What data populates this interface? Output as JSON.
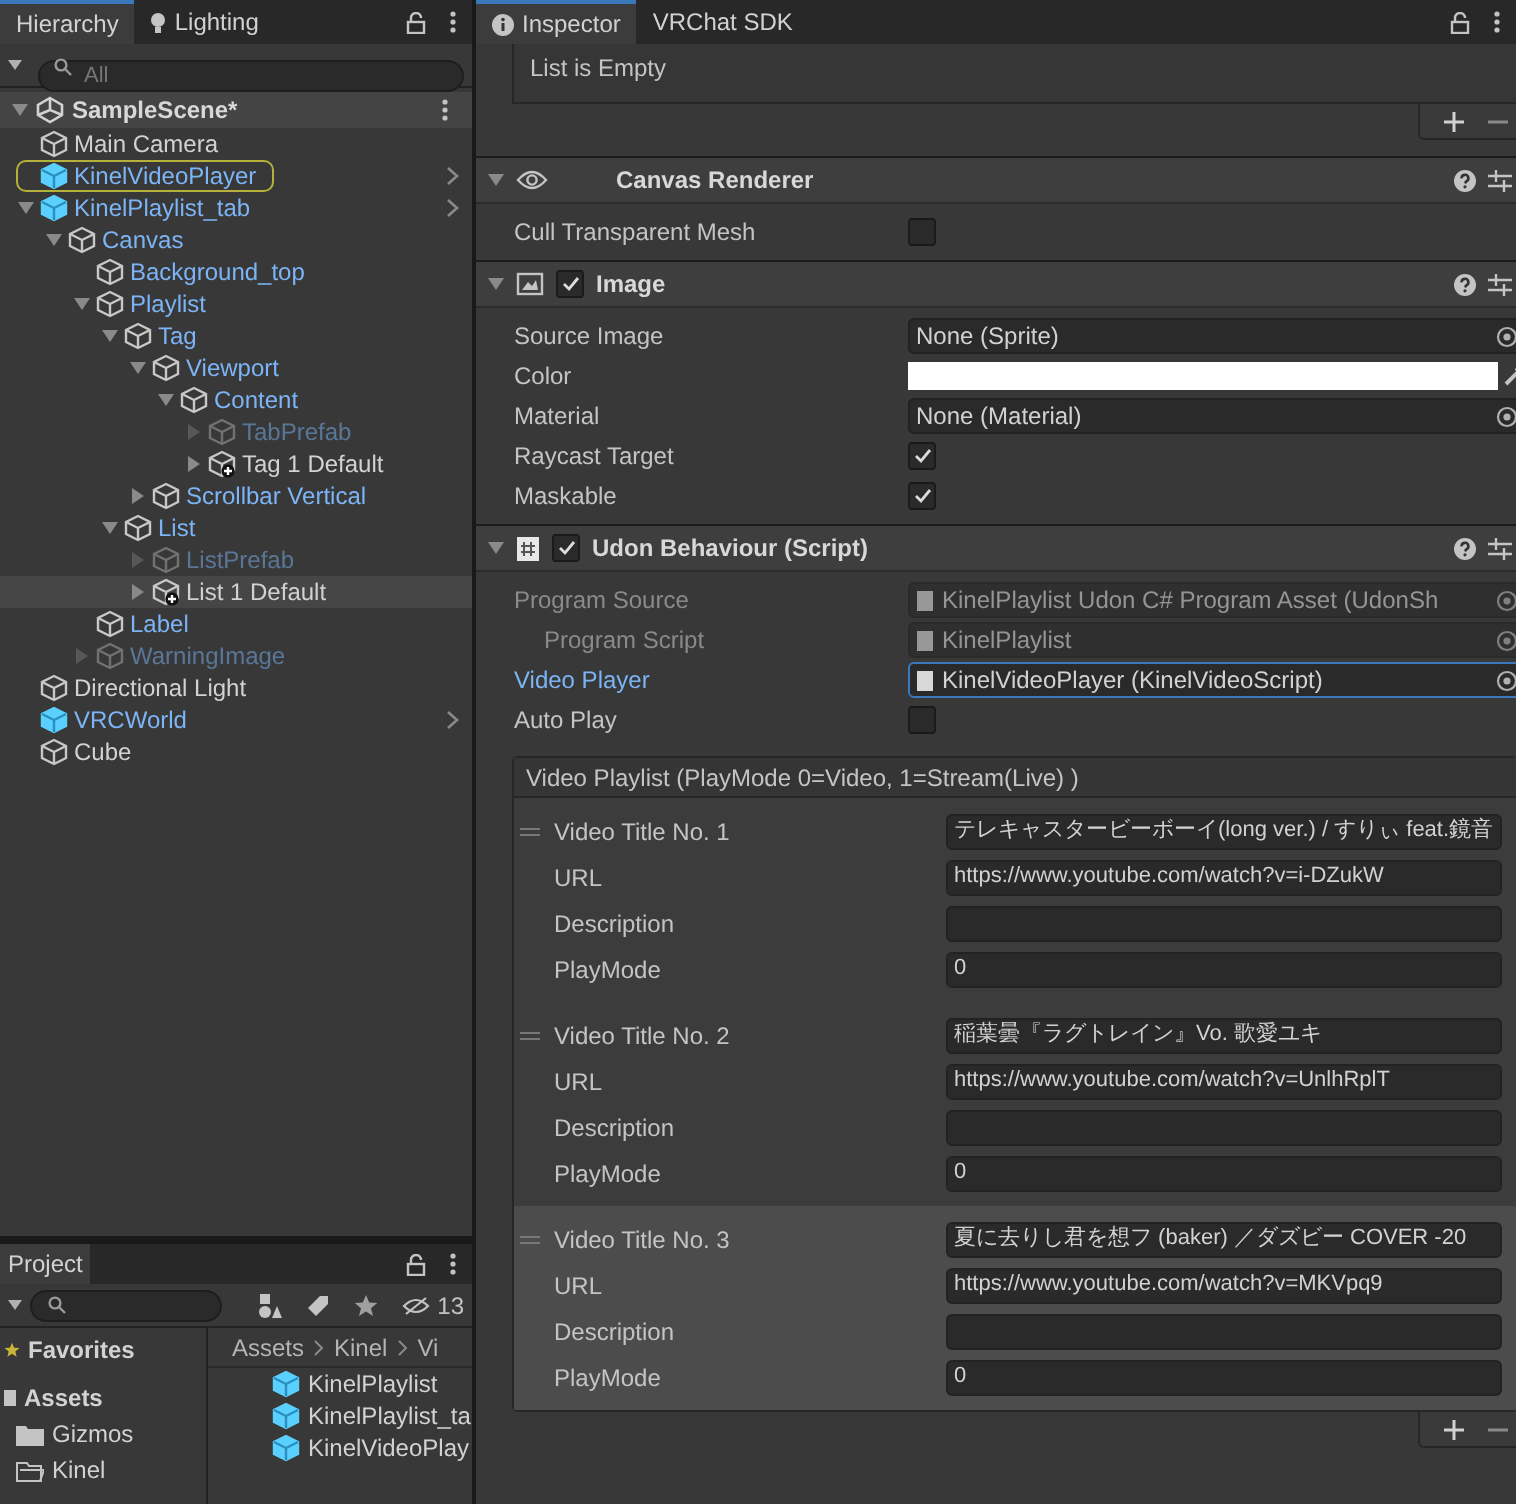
{
  "hierarchy": {
    "tabs": [
      {
        "label": "Hierarchy",
        "selected": true
      },
      {
        "label": "Lighting",
        "selected": false
      }
    ],
    "search": {
      "placeholder": "All"
    },
    "scene": {
      "name": "SampleScene*",
      "expanded": true,
      "children": [
        {
          "name": "Main Camera",
          "kind": "plain",
          "inactive": false,
          "selected": false,
          "hovered": false
        },
        {
          "name": "KinelVideoPlayer",
          "kind": "prefab_root",
          "inactive": false,
          "selected": true,
          "hovered": false
        },
        {
          "name": "KinelPlaylist_tab",
          "kind": "prefab_root",
          "inactive": false,
          "selected": false,
          "hovered": false,
          "expanded": true,
          "children": [
            {
              "name": "Canvas",
              "kind": "prefab",
              "inactive": false,
              "selected": false,
              "hovered": false,
              "expanded": true,
              "children": [
                {
                  "name": "Background_top",
                  "kind": "prefab",
                  "inactive": false,
                  "selected": false,
                  "hovered": false
                },
                {
                  "name": "Playlist",
                  "kind": "prefab",
                  "inactive": false,
                  "selected": false,
                  "hovered": false,
                  "expanded": true,
                  "children": [
                    {
                      "name": "Tag",
                      "kind": "prefab",
                      "inactive": false,
                      "selected": false,
                      "hovered": false,
                      "expanded": true,
                      "children": [
                        {
                          "name": "Viewport",
                          "kind": "prefab",
                          "inactive": false,
                          "selected": false,
                          "hovered": false,
                          "expanded": true,
                          "children": [
                            {
                              "name": "Content",
                              "kind": "prefab",
                              "inactive": false,
                              "selected": false,
                              "hovered": false,
                              "expanded": true,
                              "children": [
                                {
                                  "name": "TabPrefab",
                                  "kind": "prefab",
                                  "inactive": true,
                                  "selected": false,
                                  "hovered": false,
                                  "expanded": false
                                },
                                {
                                  "name": "Tag 1 Default",
                                  "kind": "added",
                                  "inactive": false,
                                  "selected": false,
                                  "hovered": false,
                                  "expanded": false
                                }
                              ]
                            }
                          ]
                        },
                        {
                          "name": "Scrollbar Vertical",
                          "kind": "prefab",
                          "inactive": false,
                          "selected": false,
                          "hovered": false,
                          "expanded": false
                        }
                      ]
                    },
                    {
                      "name": "List",
                      "kind": "prefab",
                      "inactive": false,
                      "selected": false,
                      "hovered": false,
                      "expanded": true,
                      "children": [
                        {
                          "name": "ListPrefab",
                          "kind": "prefab",
                          "inactive": true,
                          "selected": false,
                          "hovered": false,
                          "expanded": false
                        },
                        {
                          "name": "List 1 Default",
                          "kind": "added",
                          "inactive": false,
                          "selected": false,
                          "hovered": true,
                          "expanded": false
                        }
                      ]
                    }
                  ]
                },
                {
                  "name": "Label",
                  "kind": "prefab",
                  "inactive": false,
                  "selected": false,
                  "hovered": false
                },
                {
                  "name": "WarningImage",
                  "kind": "prefab",
                  "inactive": true,
                  "selected": false,
                  "hovered": false,
                  "expanded": false
                }
              ]
            }
          ]
        },
        {
          "name": "Directional Light",
          "kind": "plain",
          "inactive": false,
          "selected": false,
          "hovered": false
        },
        {
          "name": "VRCWorld",
          "kind": "prefab_root",
          "inactive": false,
          "selected": false,
          "hovered": false
        },
        {
          "name": "Cube",
          "kind": "plain",
          "inactive": false,
          "selected": false,
          "hovered": false
        }
      ]
    }
  },
  "project": {
    "tab": "Project",
    "hidden_count": "13",
    "favorites": "Favorites",
    "assets": "Assets",
    "folders": [
      {
        "name": "Gizmos",
        "expanded": false
      },
      {
        "name": "Kinel",
        "expanded": true
      }
    ],
    "breadcrumb": [
      "Assets",
      "Kinel",
      "Vi"
    ],
    "files": [
      "KinelPlaylist",
      "KinelPlaylist_ta",
      "KinelVideoPlay"
    ]
  },
  "inspector": {
    "tabs": [
      {
        "label": "Inspector",
        "selected": true
      },
      {
        "label": "VRChat SDK",
        "selected": false
      }
    ],
    "empty_list": "List is Empty",
    "components": [
      {
        "title": "Canvas Renderer",
        "fields": [
          {
            "label": "Cull Transparent Mesh",
            "kind": "checkbox",
            "checked": false
          }
        ]
      },
      {
        "title": "Image",
        "enabled": true,
        "fields": [
          {
            "label": "Source Image",
            "kind": "object",
            "value": "None (Sprite)"
          },
          {
            "label": "Color",
            "kind": "color",
            "color": "#ffffff"
          },
          {
            "label": "Material",
            "kind": "object",
            "value": "None (Material)"
          },
          {
            "label": "Raycast Target",
            "kind": "checkbox",
            "checked": true
          },
          {
            "label": "Maskable",
            "kind": "checkbox",
            "checked": true
          }
        ]
      },
      {
        "title": "Udon Behaviour (Script)",
        "enabled": true,
        "fields": [
          {
            "label": "Program Source",
            "kind": "object",
            "value": "KinelPlaylist Udon C# Program Asset (UdonSh",
            "disabled": true,
            "indent": false,
            "focused": false
          },
          {
            "label": "Program Script",
            "kind": "object",
            "value": "KinelPlaylist",
            "disabled": true,
            "indent": true,
            "focused": false
          },
          {
            "label": "Video Player",
            "kind": "object",
            "value": "KinelVideoPlayer (KinelVideoScript)",
            "disabled": false,
            "indent": false,
            "focused": true
          },
          {
            "label": "Auto Play",
            "kind": "checkbox",
            "checked": false
          }
        ]
      }
    ],
    "playlist": {
      "header": "Video Playlist (PlayMode 0=Video, 1=Stream(Live) )",
      "items": [
        {
          "title_label": "Video Title No. 1",
          "title": "テレキャスタービーボーイ(long ver.) / すりぃ feat.鏡音",
          "url_label": "URL",
          "url": "https://www.youtube.com/watch?v=i-DZukW",
          "description_label": "Description",
          "playmode_label": "PlayMode",
          "playmode": "0",
          "selected": false
        },
        {
          "title_label": "Video Title No. 2",
          "title": "稲葉曇『ラグトレイン』Vo. 歌愛ユキ",
          "url_label": "URL",
          "url": "https://www.youtube.com/watch?v=UnlhRplT",
          "description_label": "Description",
          "playmode_label": "PlayMode",
          "playmode": "0",
          "selected": false
        },
        {
          "title_label": "Video Title No. 3",
          "title": "夏に去りし君を想フ (baker) ／ダズビー COVER -20",
          "url_label": "URL",
          "url": "https://www.youtube.com/watch?v=MKVpq9",
          "description_label": "Description",
          "playmode_label": "PlayMode",
          "playmode": "0",
          "selected": true
        }
      ]
    }
  }
}
